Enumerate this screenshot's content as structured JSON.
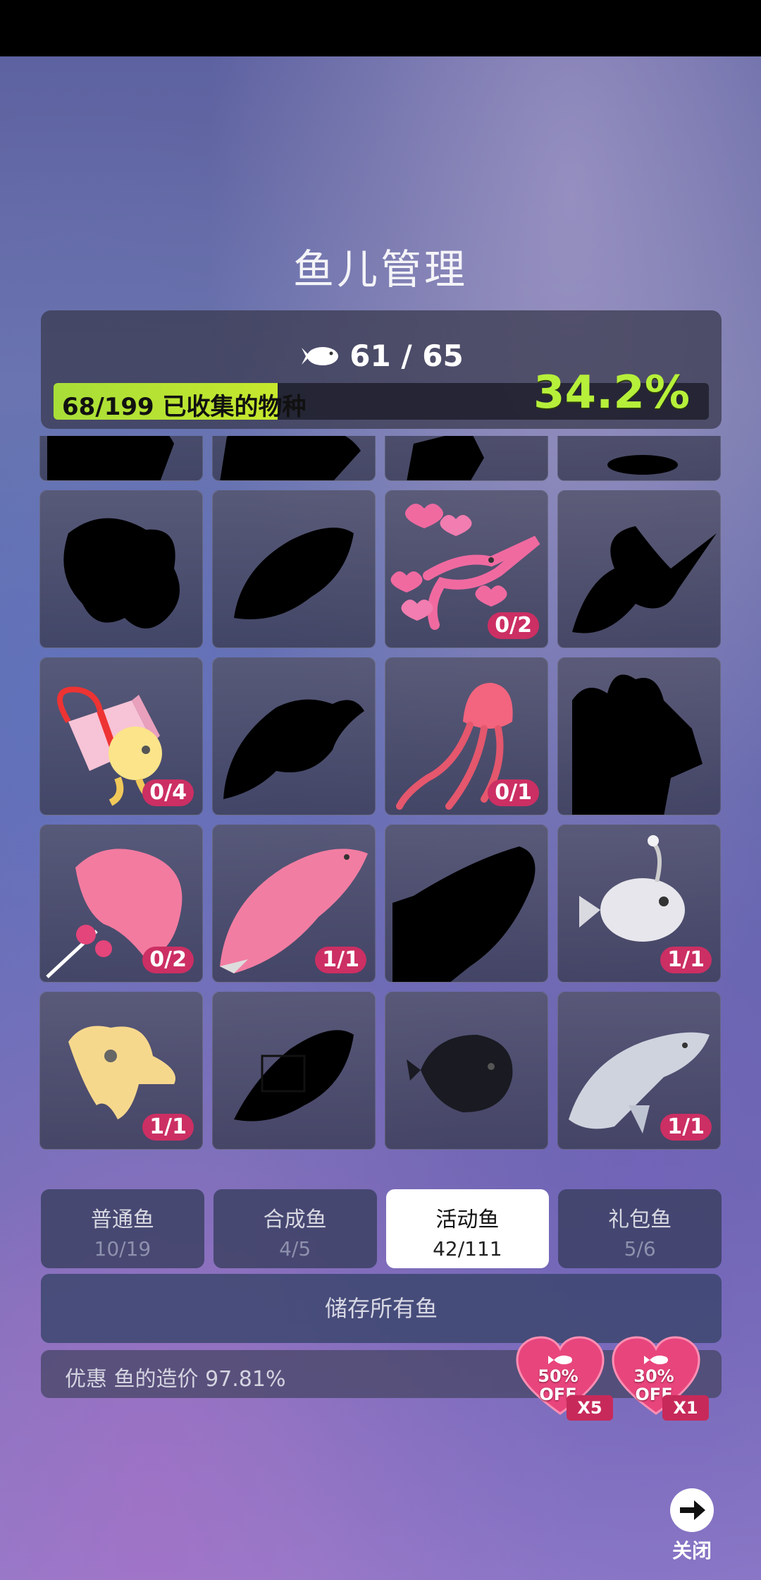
{
  "title": "鱼儿管理",
  "summary": {
    "fish_count": "61 / 65",
    "collected_label": "68/199 已收集的物种",
    "collected_fraction": 0.342,
    "percent": "34.2%"
  },
  "grid": {
    "rows": [
      [
        "",
        "",
        "",
        ""
      ],
      [
        "",
        "",
        "0/2",
        ""
      ],
      [
        "0/4",
        "",
        "0/1",
        ""
      ],
      [
        "0/2",
        "1/1",
        "",
        "1/1"
      ],
      [
        "1/1",
        "",
        "",
        "1/1"
      ],
      [
        "",
        "",
        "",
        ""
      ]
    ]
  },
  "tabs": [
    {
      "label": "普通鱼",
      "count": "10/19"
    },
    {
      "label": "合成鱼",
      "count": "4/5"
    },
    {
      "label": "活动鱼",
      "count": "42/111"
    },
    {
      "label": "礼包鱼",
      "count": "5/6"
    }
  ],
  "store_all_label": "储存所有鱼",
  "discount_text": "优惠 鱼的造价 97.81%",
  "coupons": [
    {
      "percent": "50%",
      "off": "OFF",
      "mult": "X5"
    },
    {
      "percent": "30%",
      "off": "OFF",
      "mult": "X1"
    }
  ],
  "close_label": "关闭",
  "colors": {
    "badge": "#cc2f63",
    "progress": "#b6f03a",
    "heart": "#e8457d"
  }
}
